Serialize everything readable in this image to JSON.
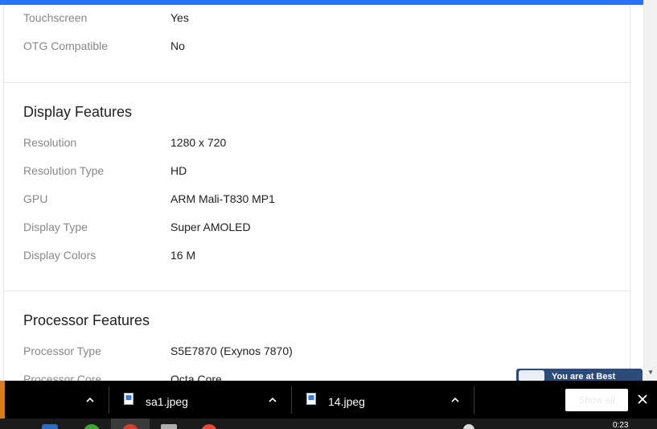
{
  "page": {
    "top_rows": [
      {
        "label": "Touchscreen",
        "value": "Yes"
      },
      {
        "label": "OTG Compatible",
        "value": "No"
      }
    ],
    "display": {
      "title": "Display Features",
      "rows": [
        {
          "label": "Resolution",
          "value": "1280 x 720"
        },
        {
          "label": "Resolution Type",
          "value": "HD"
        },
        {
          "label": "GPU",
          "value": "ARM Mali-T830 MP1"
        },
        {
          "label": "Display Type",
          "value": "Super AMOLED"
        },
        {
          "label": "Display Colors",
          "value": "16 M"
        }
      ]
    },
    "processor": {
      "title": "Processor Features",
      "rows": [
        {
          "label": "Processor Type",
          "value": "S5E7870 (Exynos 7870)"
        },
        {
          "label": "Processor Core",
          "value": "Octa Core"
        }
      ]
    }
  },
  "promo": {
    "text": "You are at Best"
  },
  "downloads": {
    "items": [
      {
        "name": "sa1.jpeg"
      },
      {
        "name": "14.jpeg"
      }
    ],
    "show_all": "Show all"
  },
  "taskbar": {
    "clock": "0:23"
  },
  "colors": {
    "accent": "#2874f0",
    "label": "#878787",
    "value": "#212121"
  }
}
